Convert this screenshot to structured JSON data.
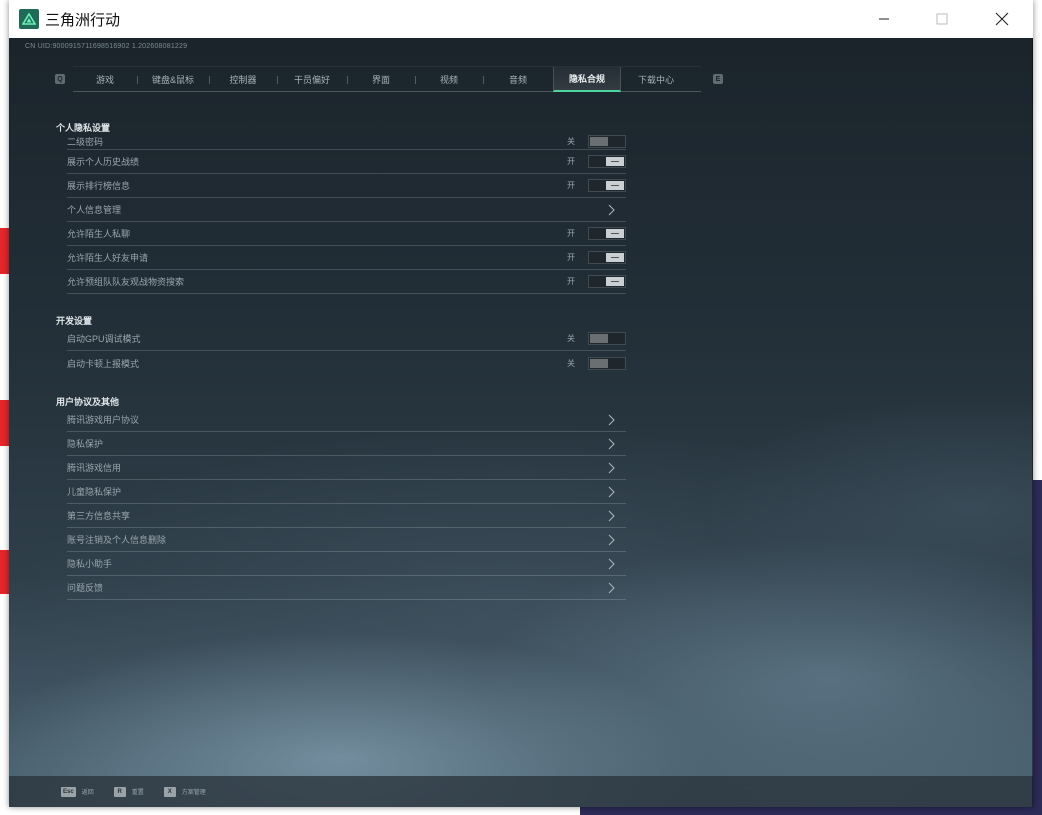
{
  "window": {
    "title": "三角洲行动",
    "controls": {
      "minimize": "minimize-icon",
      "maximize": "maximize-icon",
      "close": "close-icon"
    }
  },
  "uid_text": "CN UID:9000915711698516902 1.202608081229",
  "tabs": {
    "left_key": "Q",
    "right_key": "E",
    "items": [
      {
        "label": "游戏"
      },
      {
        "label": "键盘&鼠标"
      },
      {
        "label": "控制器"
      },
      {
        "label": "干员偏好"
      },
      {
        "label": "界面"
      },
      {
        "label": "视频"
      },
      {
        "label": "音频"
      },
      {
        "label": "隐私合规"
      },
      {
        "label": "下载中心"
      }
    ],
    "active": "隐私合规"
  },
  "sections": {
    "personal": {
      "title": "个人隐私设置",
      "rows": [
        {
          "label": "二级密码",
          "state": "关"
        },
        {
          "label": "展示个人历史战绩",
          "state": "开"
        },
        {
          "label": "展示排行榜信息",
          "state": "开"
        },
        {
          "label": "个人信息管理"
        },
        {
          "label": "允许陌生人私聊",
          "state": "开"
        },
        {
          "label": "允许陌生人好友申请",
          "state": "开"
        },
        {
          "label": "允许预组队队友观战物资搜索",
          "state": "开"
        }
      ]
    },
    "dev": {
      "title": "开发设置",
      "rows": [
        {
          "label": "启动GPU调试模式",
          "state": "关"
        },
        {
          "label": "启动卡顿上报模式",
          "state": "关"
        }
      ]
    },
    "agreements": {
      "title": "用户协议及其他",
      "rows": [
        {
          "label": "腾讯游戏用户协议"
        },
        {
          "label": "隐私保护"
        },
        {
          "label": "腾讯游戏信用"
        },
        {
          "label": "儿童隐私保护"
        },
        {
          "label": "第三方信息共享"
        },
        {
          "label": "账号注销及个人信息删除"
        },
        {
          "label": "隐私小助手"
        },
        {
          "label": "问题反馈"
        }
      ]
    }
  },
  "bottom_hints": [
    {
      "key": "Esc",
      "label": "返回"
    },
    {
      "key": "R",
      "label": "重置"
    },
    {
      "key": "X",
      "label": "方案管理"
    }
  ],
  "colors": {
    "accent": "#4fd4a0",
    "app_icon_bg": "#1f6b57"
  }
}
